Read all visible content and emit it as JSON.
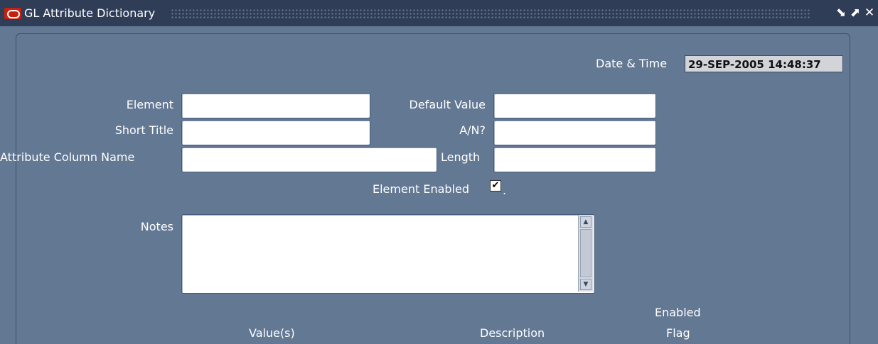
{
  "window": {
    "title": "GL Attribute Dictionary",
    "controls": {
      "minimize": "⬊",
      "maximize": "⬈",
      "close": "✕"
    }
  },
  "form": {
    "date_time_label": "Date & Time",
    "date_time_value": "29-SEP-2005 14:48:37",
    "element_label": "Element",
    "element_value": "",
    "default_value_label": "Default Value",
    "default_value_value": "",
    "short_title_label": "Short Title",
    "short_title_value": "",
    "an_label": "A/N?",
    "an_value": "",
    "attribute_column_label": "Attribute Column Name",
    "attribute_column_value": "",
    "length_label": "Length",
    "length_value": "",
    "element_enabled_label": "Element Enabled",
    "element_enabled_checked": true,
    "notes_label": "Notes",
    "notes_value": ""
  },
  "table": {
    "col_values": "Value(s)",
    "col_description": "Description",
    "col_enabled_line1": "Enabled",
    "col_enabled_line2": "Flag"
  }
}
